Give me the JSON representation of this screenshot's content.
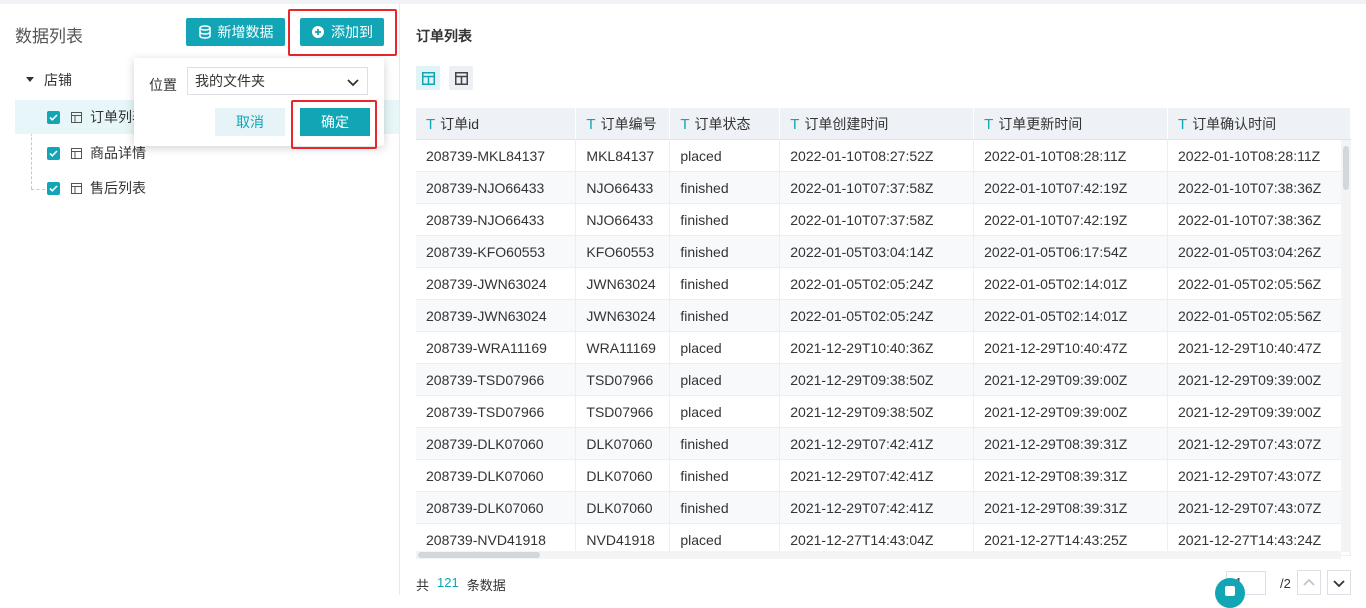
{
  "left": {
    "title": "数据列表",
    "new_data_label": "新增数据",
    "add_to_label": "添加到",
    "tree": {
      "root_label": "店铺",
      "items": [
        {
          "label": "订单列表",
          "checked": true,
          "selected": true
        },
        {
          "label": "商品详情",
          "checked": true,
          "selected": false
        },
        {
          "label": "售后列表",
          "checked": true,
          "selected": false
        }
      ]
    }
  },
  "popover": {
    "location_label": "位置",
    "location_value": "我的文件夹",
    "cancel_label": "取消",
    "confirm_label": "确定"
  },
  "right": {
    "title": "订单列表",
    "columns": [
      "订单id",
      "订单编号",
      "订单状态",
      "订单创建时间",
      "订单更新时间",
      "订单确认时间"
    ],
    "rows": [
      [
        "208739-MKL84137",
        "MKL84137",
        "placed",
        "2022-01-10T08:27:52Z",
        "2022-01-10T08:28:11Z",
        "2022-01-10T08:28:11Z"
      ],
      [
        "208739-NJO66433",
        "NJO66433",
        "finished",
        "2022-01-10T07:37:58Z",
        "2022-01-10T07:42:19Z",
        "2022-01-10T07:38:36Z"
      ],
      [
        "208739-NJO66433",
        "NJO66433",
        "finished",
        "2022-01-10T07:37:58Z",
        "2022-01-10T07:42:19Z",
        "2022-01-10T07:38:36Z"
      ],
      [
        "208739-KFO60553",
        "KFO60553",
        "finished",
        "2022-01-05T03:04:14Z",
        "2022-01-05T06:17:54Z",
        "2022-01-05T03:04:26Z"
      ],
      [
        "208739-JWN63024",
        "JWN63024",
        "finished",
        "2022-01-05T02:05:24Z",
        "2022-01-05T02:14:01Z",
        "2022-01-05T02:05:56Z"
      ],
      [
        "208739-JWN63024",
        "JWN63024",
        "finished",
        "2022-01-05T02:05:24Z",
        "2022-01-05T02:14:01Z",
        "2022-01-05T02:05:56Z"
      ],
      [
        "208739-WRA11169",
        "WRA11169",
        "placed",
        "2021-12-29T10:40:36Z",
        "2021-12-29T10:40:47Z",
        "2021-12-29T10:40:47Z"
      ],
      [
        "208739-TSD07966",
        "TSD07966",
        "placed",
        "2021-12-29T09:38:50Z",
        "2021-12-29T09:39:00Z",
        "2021-12-29T09:39:00Z"
      ],
      [
        "208739-TSD07966",
        "TSD07966",
        "placed",
        "2021-12-29T09:38:50Z",
        "2021-12-29T09:39:00Z",
        "2021-12-29T09:39:00Z"
      ],
      [
        "208739-DLK07060",
        "DLK07060",
        "finished",
        "2021-12-29T07:42:41Z",
        "2021-12-29T08:39:31Z",
        "2021-12-29T07:43:07Z"
      ],
      [
        "208739-DLK07060",
        "DLK07060",
        "finished",
        "2021-12-29T07:42:41Z",
        "2021-12-29T08:39:31Z",
        "2021-12-29T07:43:07Z"
      ],
      [
        "208739-DLK07060",
        "DLK07060",
        "finished",
        "2021-12-29T07:42:41Z",
        "2021-12-29T08:39:31Z",
        "2021-12-29T07:43:07Z"
      ],
      [
        "208739-NVD41918",
        "NVD41918",
        "placed",
        "2021-12-27T14:43:04Z",
        "2021-12-27T14:43:25Z",
        "2021-12-27T14:43:24Z"
      ]
    ],
    "footer": {
      "prefix": "共",
      "total": "121",
      "suffix": "条数据",
      "page_current": "1",
      "page_total": "/2"
    }
  },
  "colors": {
    "accent": "#12a5b6",
    "highlight_box": "#e8262b",
    "selected_row": "#e7f6f8",
    "header_bg": "#eef2f6"
  },
  "icons": [
    "database-icon",
    "plus-circle-icon",
    "caret-down-icon",
    "checkbox-icon",
    "table-icon",
    "chevron-down-icon",
    "card-view-icon",
    "table-view-icon",
    "text-type-icon",
    "chevron-up-icon",
    "help-icon"
  ]
}
